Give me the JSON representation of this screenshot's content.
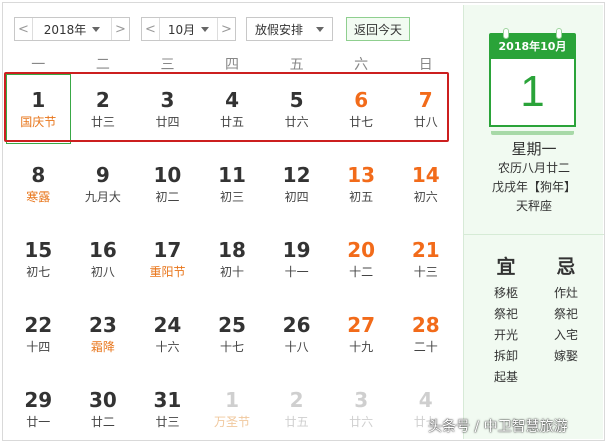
{
  "toolbar": {
    "year": "2018年",
    "month": "10月",
    "holiday": "放假安排",
    "today_button": "返回今天",
    "prev_arrow": "<",
    "next_arrow": ">"
  },
  "weekdays": [
    "一",
    "二",
    "三",
    "四",
    "五",
    "六",
    "日"
  ],
  "calendar": {
    "rows": [
      [
        {
          "day": "1",
          "lunar": "国庆节",
          "festival": true,
          "today": true
        },
        {
          "day": "2",
          "lunar": "廿三"
        },
        {
          "day": "3",
          "lunar": "廿四"
        },
        {
          "day": "4",
          "lunar": "廿五"
        },
        {
          "day": "5",
          "lunar": "廿六"
        },
        {
          "day": "6",
          "lunar": "廿七",
          "weekend": true
        },
        {
          "day": "7",
          "lunar": "廿八",
          "weekend": true
        }
      ],
      [
        {
          "day": "8",
          "lunar": "寒露",
          "festival": true
        },
        {
          "day": "9",
          "lunar": "九月大"
        },
        {
          "day": "10",
          "lunar": "初二"
        },
        {
          "day": "11",
          "lunar": "初三"
        },
        {
          "day": "12",
          "lunar": "初四"
        },
        {
          "day": "13",
          "lunar": "初五",
          "weekend": true
        },
        {
          "day": "14",
          "lunar": "初六",
          "weekend": true
        }
      ],
      [
        {
          "day": "15",
          "lunar": "初七"
        },
        {
          "day": "16",
          "lunar": "初八"
        },
        {
          "day": "17",
          "lunar": "重阳节",
          "festival": true
        },
        {
          "day": "18",
          "lunar": "初十"
        },
        {
          "day": "19",
          "lunar": "十一"
        },
        {
          "day": "20",
          "lunar": "十二",
          "weekend": true
        },
        {
          "day": "21",
          "lunar": "十三",
          "weekend": true
        }
      ],
      [
        {
          "day": "22",
          "lunar": "十四"
        },
        {
          "day": "23",
          "lunar": "霜降",
          "festival": true
        },
        {
          "day": "24",
          "lunar": "十六"
        },
        {
          "day": "25",
          "lunar": "十七"
        },
        {
          "day": "26",
          "lunar": "十八"
        },
        {
          "day": "27",
          "lunar": "十九",
          "weekend": true
        },
        {
          "day": "28",
          "lunar": "二十",
          "weekend": true
        }
      ],
      [
        {
          "day": "29",
          "lunar": "廿一"
        },
        {
          "day": "30",
          "lunar": "廿二"
        },
        {
          "day": "31",
          "lunar": "廿三"
        },
        {
          "day": "1",
          "lunar": "万圣节",
          "festival": true,
          "faded": true
        },
        {
          "day": "2",
          "lunar": "廿五",
          "faded": true
        },
        {
          "day": "3",
          "lunar": "廿六",
          "faded": true,
          "weekend": true
        },
        {
          "day": "4",
          "lunar": "廿七",
          "faded": true,
          "weekend": true
        }
      ]
    ]
  },
  "side": {
    "header": "2018年10月",
    "big_day": "1",
    "weekday": "星期一",
    "lunar_date": "农历八月廿二",
    "ganzhi": "戊戌年【狗年】",
    "zodiac": "天秤座",
    "yi_title": "宜",
    "ji_title": "忌",
    "yi": [
      "移柩",
      "祭祀",
      "开光",
      "拆卸",
      "起基"
    ],
    "ji": [
      "作灶",
      "祭祀",
      "入宅",
      "嫁娶"
    ]
  },
  "watermark": "头条号 / 中卫智慧旅游",
  "colors": {
    "accent_green": "#2aa339",
    "weekend_orange": "#f26b1a",
    "festival_orange": "#e8751a",
    "highlight_red": "#cc1f1f"
  }
}
